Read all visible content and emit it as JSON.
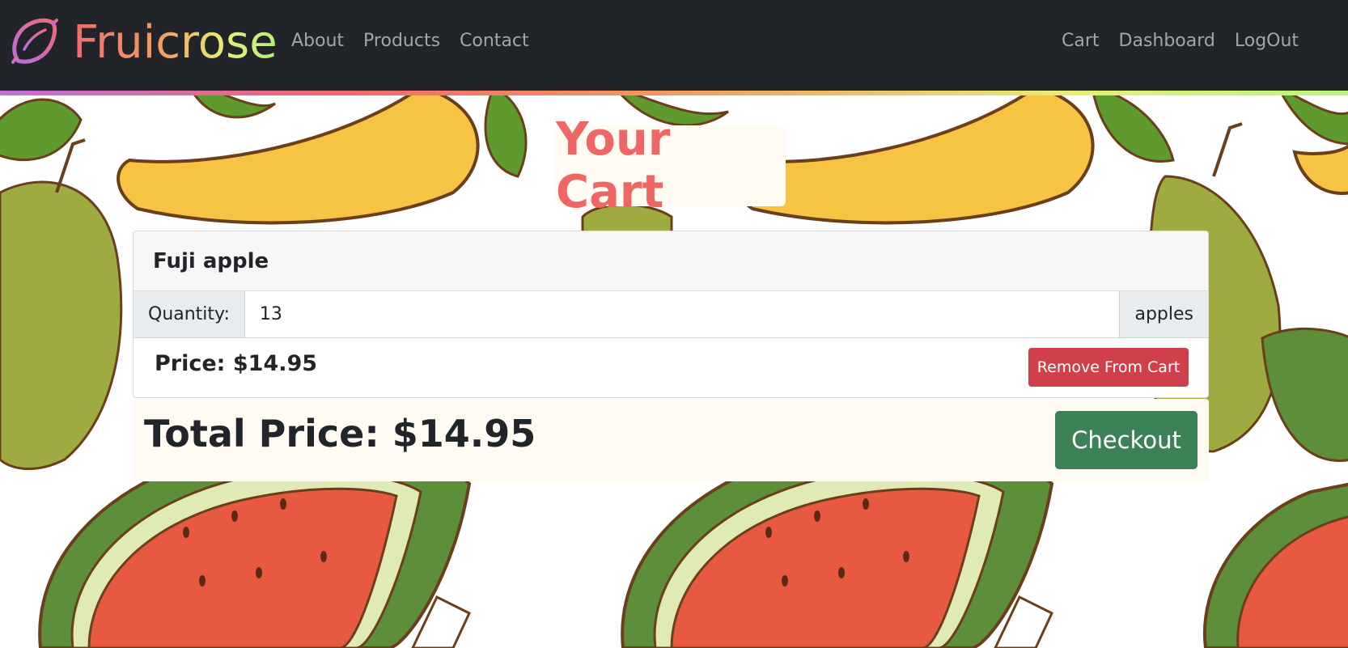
{
  "nav": {
    "brand": "Fruicrose",
    "brand_icon": "lemon-icon",
    "left_links": [
      "About",
      "Products",
      "Contact"
    ],
    "right_links": [
      "Cart",
      "Dashboard",
      "LogOut"
    ]
  },
  "page": {
    "title": "Your Cart"
  },
  "cart": {
    "item_name": "Fuji apple",
    "quantity_label": "Quantity:",
    "quantity_value": "13",
    "quantity_unit": "apples",
    "price_text": "Price: $14.95",
    "remove_label": "Remove From Cart"
  },
  "summary": {
    "total_text": "Total Price: $14.95",
    "checkout_label": "Checkout"
  },
  "colors": {
    "navbar_bg": "#212428",
    "title_color": "#ef6764",
    "remove_button": "#d0404b",
    "checkout_button": "#3b8257"
  }
}
